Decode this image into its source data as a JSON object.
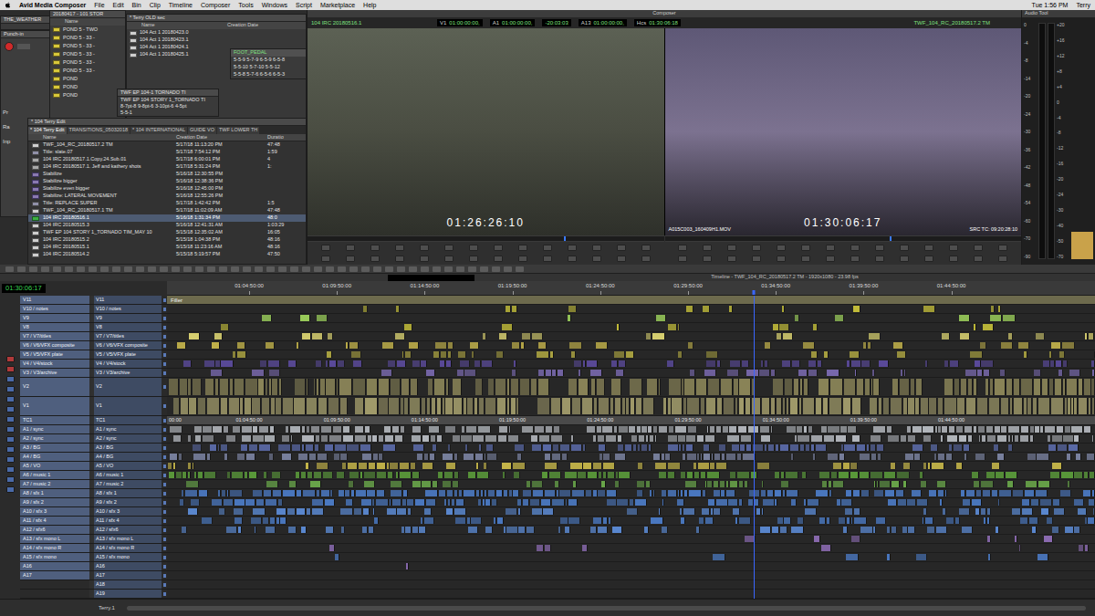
{
  "menu_bar": {
    "app": "Avid Media Composer",
    "items": [
      "File",
      "Edit",
      "Bin",
      "Clip",
      "Timeline",
      "Composer",
      "Tools",
      "Windows",
      "Script",
      "Marketplace",
      "Help"
    ],
    "clock": "Tue 1:56 PM",
    "user": "Terry"
  },
  "weather_window": {
    "title": "THE_WEATHER"
  },
  "punch_in": {
    "title": "Punch-in",
    "labels": [
      "Pr",
      "Ra",
      "Inp"
    ],
    "record_armed": true
  },
  "pond_bin": {
    "title": "20180417 - 101 STOR",
    "column": "Name",
    "rows": [
      "POND 5 - TWO",
      "POND 5 - 33 -",
      "POND 5 - 33 -",
      "POND 5 - 33 -",
      "POND 5 - 33 -",
      "POND 5 - 33 -",
      "POND",
      "POND",
      "POND"
    ]
  },
  "old_sec_bin": {
    "title": "* Terry OLD sec",
    "columns": [
      "Name",
      "Creation Date"
    ],
    "rows": [
      "104 Act 1 20180423.0",
      "104 Act 1 20180423.1",
      "104 Act 1 20180424.1",
      "104 Act 1 20180425.1"
    ]
  },
  "foot_pedal_bin": {
    "tab": "FOOT_PEDAL",
    "rows": [
      "5-5-9 5-7-9 6-5-9 6-5-8",
      "5-5-10 5-7-10 5-5-12",
      "5-5-8 5-7-6 6-5-6 6-5-3"
    ]
  },
  "tornado_bin": {
    "title": "TWF EP 104-1 TORNADO TI",
    "rows": [
      "TWF EP 104 STORY 1_TORNADO TI",
      "8-7pt-8 9-8pt-6 3-10pt-6 4-5pt",
      "5-5-1"
    ]
  },
  "main_bin": {
    "title": "* 104 Terry Edit",
    "tabs": [
      {
        "label": "* 104 Terry Edit",
        "selected": true
      },
      {
        "label": "TRANSITIONS_05032018",
        "selected": false
      },
      {
        "label": "* 104 INTERNATIONAL",
        "selected": false
      },
      {
        "label": "GUIDE VO",
        "selected": false
      },
      {
        "label": "TWF LOWER TH",
        "selected": false
      }
    ],
    "columns": [
      "Name",
      "Creation Date",
      "Duratio"
    ],
    "rows": [
      {
        "name": "TWF_104_RC_20180517.2 TM",
        "date": "5/17/18 11:13:20 PM",
        "duration": "47:48",
        "kind": "sequence",
        "selected": false
      },
      {
        "name": "Title: slate.07",
        "date": "5/17/18 7:54:12 PM",
        "duration": "1:59",
        "kind": "title",
        "selected": false
      },
      {
        "name": "104 IRC 20180517.1.Copy.24.Sub.01",
        "date": "5/17/18 6:00:01 PM",
        "duration": "4",
        "kind": "subclip",
        "selected": false
      },
      {
        "name": "104 IRC 20180517.1. Jeff and kathery shots",
        "date": "5/17/18 5:31:24 PM",
        "duration": "1:",
        "kind": "subclip",
        "selected": false
      },
      {
        "name": "Stabilize",
        "date": "5/16/18 12:30:55 PM",
        "kind": "effect",
        "selected": false
      },
      {
        "name": "Stabilize bigger",
        "date": "5/16/18 12:38:36 PM",
        "kind": "effect",
        "selected": false
      },
      {
        "name": "Stabilize even bigger",
        "date": "5/16/18 12:45:00 PM",
        "kind": "effect",
        "selected": false
      },
      {
        "name": "Stabilize: LATERAL MOVEMENT",
        "date": "5/16/18 12:55:26 PM",
        "kind": "effect",
        "selected": false
      },
      {
        "name": "Title: REPLACE SUPER",
        "date": "5/17/18 1:42:42 PM",
        "duration": "1:5",
        "kind": "title",
        "selected": false
      },
      {
        "name": "TWF_104_RC_20180517.1 TM",
        "date": "5/17/18 11:02:09 AM",
        "duration": "47:48",
        "kind": "sequence",
        "selected": false
      },
      {
        "name": "104 IRC 20180516.1",
        "date": "5/16/18 1:31:34 PM",
        "duration": "48:0",
        "kind": "sequence",
        "selected": true
      },
      {
        "name": "104 IRC 20180515.3",
        "date": "5/16/18 12:41:31 AM",
        "duration": "1:03:29",
        "kind": "sequence",
        "selected": false
      },
      {
        "name": "TWF EP 104 STORY 1_TORNADO TIM_MAY 10",
        "date": "5/15/18 12:35:02 AM",
        "duration": "16:05",
        "kind": "sequence",
        "selected": false
      },
      {
        "name": "104 IRC 20180515.2",
        "date": "5/15/18 1:04:38 PM",
        "duration": "48:16",
        "kind": "sequence",
        "selected": false
      },
      {
        "name": "104 IRC 20180515.1",
        "date": "5/15/18 11:23:16 AM",
        "duration": "48:16",
        "kind": "sequence",
        "selected": false
      },
      {
        "name": "104 IRC 20180514.2",
        "date": "5/15/18 5:19:57 PM",
        "duration": "47:50",
        "kind": "sequence",
        "selected": false
      }
    ]
  },
  "composer": {
    "title": "Composer",
    "source_name": "104 IRC 20180516.1",
    "record_name": "TWF_104_RC_20180517.2 TM",
    "fields": [
      {
        "label": "V1",
        "value": "01:00:00:00,"
      },
      {
        "label": "A1",
        "value": "01:00:00:00,"
      },
      {
        "label": "",
        "value": "-20:03:03"
      },
      {
        "label": "A13",
        "value": "01:00:00:00,"
      },
      {
        "label": "Hcs",
        "value": "01:30:06:18"
      }
    ],
    "source_monitor": {
      "timecode": "01:26:26:10",
      "level": 0.72
    },
    "record_monitor": {
      "timecode": "01:30:06:17",
      "clip": "A015C003_160409H1.MOV",
      "src_tc": "SRC TC: 09:20:28:10",
      "level": 0.63
    }
  },
  "audio_tool": {
    "title": "Audio Tool",
    "left_scale": [
      "0",
      "-4",
      "-8",
      "-14",
      "-20",
      "-24",
      "-30",
      "-36",
      "-42",
      "-48",
      "-54",
      "-60",
      "-70",
      "-90"
    ],
    "right_scale": [
      "+20",
      "+16",
      "+12",
      "+8",
      "+4",
      "0",
      "-4",
      "-8",
      "-12",
      "-16",
      "-20",
      "-24",
      "-30",
      "-40",
      "-50",
      "-70"
    ],
    "levels": [
      0,
      0
    ]
  },
  "timeline": {
    "title": "Timeline - TWF_104_RC_20180517.2 TM - 1920x1080 - 23.98 fps",
    "timecode": "01:30:06:17",
    "ruler": [
      "01:04:50:00",
      "01:09:50:00",
      "01:14:50:00",
      "01:19:50:00",
      "01:24:50:00",
      "01:29:50:00",
      "01:34:50:00",
      "01:39:50:00",
      "01:44:50:00"
    ],
    "tc_start": "00:00",
    "playhead": 0.632,
    "user_tab": "Terry.1",
    "tracks": [
      {
        "record": "V11",
        "source": "V11",
        "kind": "filler",
        "clip": "Filler",
        "color": "#6d6a4d"
      },
      {
        "record": "V10 / notes",
        "source": "V10 / notes",
        "kind": "video",
        "color": "#c8c23a",
        "level": 0.12
      },
      {
        "record": "V9",
        "source": "V9",
        "kind": "video",
        "color": "#9acd5a",
        "level": 0.07
      },
      {
        "record": "V8",
        "source": "V8",
        "kind": "video",
        "color": "#c8c23a",
        "level": 0.1
      },
      {
        "record": "V7 / V7/titles",
        "source": "V7 / V7/titles",
        "kind": "video",
        "color": "#d8d070",
        "level": 0.22
      },
      {
        "record": "V6 / V6/VFX composite",
        "source": "V6 / V6/VFX composite",
        "kind": "video",
        "color": "#c0b04a",
        "level": 0.22
      },
      {
        "record": "V5 / V5/VFX plate",
        "source": "V5 / V5/VFX plate",
        "kind": "video",
        "color": "#a8a040",
        "level": 0.18
      },
      {
        "record": "V4 / V4/stock",
        "source": "V4 / V4/stock",
        "kind": "video",
        "color": "#5a4a9a",
        "level": 0.5
      },
      {
        "record": "V3 / V3/archive",
        "source": "V3 / V3/archive",
        "kind": "video",
        "color": "#7a6ab0",
        "level": 0.3
      },
      {
        "record": "V2",
        "source": "V2",
        "kind": "picture",
        "color": "#8a8458",
        "level": 0.85
      },
      {
        "record": "V1",
        "source": "V1",
        "kind": "picture",
        "color": "#a09a6a",
        "level": 0.95
      },
      {
        "record": "TC1",
        "source": "TC1",
        "kind": "tc"
      },
      {
        "record": "A1 / sync",
        "source": "A1 / sync",
        "kind": "audio",
        "color": "#b4b8be",
        "level": 0.8
      },
      {
        "record": "A2 / sync",
        "source": "A2 / sync",
        "kind": "audio",
        "color": "#b4b8be",
        "level": 0.75
      },
      {
        "record": "A3 / BG",
        "source": "A3 / BG",
        "kind": "audio",
        "color": "#5a6aa8",
        "level": 0.6
      },
      {
        "record": "A4 / BG",
        "source": "A4 / BG",
        "kind": "audio",
        "color": "#7a82a0",
        "level": 0.55
      },
      {
        "record": "A5 / VO",
        "source": "A5 / VO",
        "kind": "audio",
        "color": "#c8b84a",
        "level": 0.35
      },
      {
        "record": "A6 / music 1",
        "source": "A6 / music 1",
        "kind": "audio",
        "color": "#5a9a3a",
        "level": 0.6
      },
      {
        "record": "A7 / music 2",
        "source": "A7 / music 2",
        "kind": "audio",
        "color": "#6aa84a",
        "level": 0.5
      },
      {
        "record": "A8 / sfx 1",
        "source": "A8 / sfx 1",
        "kind": "audio",
        "color": "#4a78c0",
        "level": 0.7
      },
      {
        "record": "A9 / sfx 2",
        "source": "A9 / sfx 2",
        "kind": "audio",
        "color": "#4a78c0",
        "level": 0.6
      },
      {
        "record": "A10 / sfx 3",
        "source": "A10 / sfx 3",
        "kind": "audio",
        "color": "#5a88d0",
        "level": 0.5
      },
      {
        "record": "A11 / sfx 4",
        "source": "A11 / sfx 4",
        "kind": "audio",
        "color": "#4a78c0",
        "level": 0.45
      },
      {
        "record": "A12 / sfx6",
        "source": "A12 / sfx6",
        "kind": "audio",
        "color": "#5a88d0",
        "level": 0.3
      },
      {
        "record": "A13 / sfx mono L",
        "source": "A13 / sfx mono L",
        "kind": "audio",
        "color": "#8a6ab0",
        "level": 0.06
      },
      {
        "record": "A14 / sfx mono R",
        "source": "A14 / sfx mono R",
        "kind": "audio",
        "color": "#8a6ab0",
        "level": 0.05
      },
      {
        "record": "A15 / sfx mono",
        "source": "A15 / sfx mono",
        "kind": "audio",
        "color": "#4a78c0",
        "level": 0.05
      },
      {
        "record": "A16",
        "source": "A16",
        "kind": "audio",
        "color": "#8a6ab0",
        "level": 0.01
      },
      {
        "record": "A17",
        "source": "A17",
        "kind": "audio"
      },
      {
        "record": null,
        "source": "A18",
        "kind": "audio"
      },
      {
        "record": null,
        "source": "A19",
        "kind": "audio"
      }
    ]
  }
}
